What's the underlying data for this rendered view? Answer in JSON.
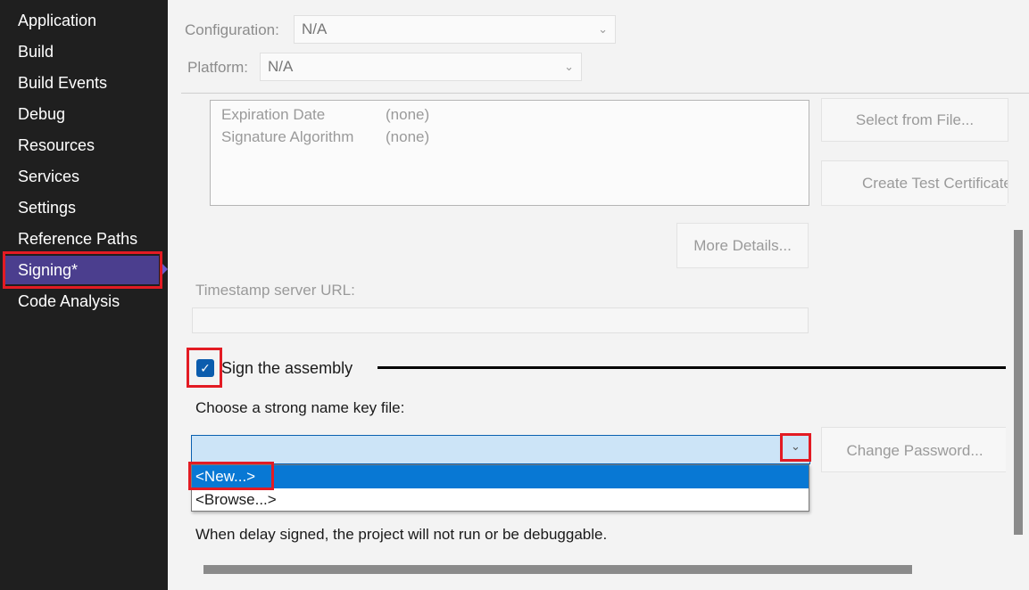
{
  "sidebar": {
    "items": [
      {
        "label": "Application"
      },
      {
        "label": "Build"
      },
      {
        "label": "Build Events"
      },
      {
        "label": "Debug"
      },
      {
        "label": "Resources"
      },
      {
        "label": "Services"
      },
      {
        "label": "Settings"
      },
      {
        "label": "Reference Paths"
      },
      {
        "label": "Signing*",
        "active": true
      },
      {
        "label": "Code Analysis"
      }
    ]
  },
  "config": {
    "configuration_label": "Configuration:",
    "configuration_value": "N/A",
    "platform_label": "Platform:",
    "platform_value": "N/A"
  },
  "certificate": {
    "rows": [
      {
        "name": "Expiration Date",
        "value": "(none)"
      },
      {
        "name": "Signature Algorithm",
        "value": "(none)"
      }
    ],
    "select_from_file": "Select from File...",
    "create_test_certificate": "Create Test Certificate",
    "more_details": "More Details..."
  },
  "timestamp": {
    "label": "Timestamp server URL:",
    "value": ""
  },
  "signing": {
    "sign_assembly_label": "Sign the assembly",
    "sign_assembly_checked": true,
    "choose_key_label": "Choose a strong name key file:",
    "key_value": "",
    "options": [
      "<New...>",
      "<Browse...>"
    ],
    "selected_option": "<New...>",
    "change_password": "Change Password...",
    "delay_note": "When delay signed, the project will not run or be debuggable."
  },
  "colors": {
    "sidebar_bg": "#1f1f1f",
    "active_item": "#4b3e8e",
    "highlight_red": "#e31b23",
    "selection_blue": "#0878d4"
  }
}
